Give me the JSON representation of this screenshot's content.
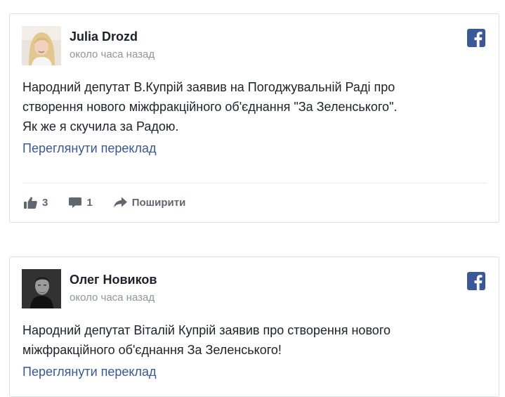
{
  "posts": [
    {
      "author": "Julia Drozd",
      "time": "около часа назад",
      "text_lines": [
        "Народний депутат В.Купрій заявив на Погоджувальній Раді про",
        "створення нового міжфракційного об'єднання \"За Зеленського\".",
        "Як же я скучила за Радою."
      ],
      "translate_label": "Переглянути переклад",
      "likes": "3",
      "comments": "1",
      "share_label": "Поширити"
    },
    {
      "author": "Олег Новиков",
      "time": "около часа назад",
      "text_lines": [
        "Народний депутат Віталій Купрій заявив про створення нового",
        "міжфракційного об'єднання За Зеленського!"
      ],
      "translate_label": "Переглянути переклад"
    }
  ],
  "icons": {
    "brand": "facebook-icon",
    "like": "thumbs-up-icon",
    "comment": "comment-icon",
    "share": "share-arrow-icon"
  },
  "colors": {
    "brand": "#3b5998",
    "link": "#385898",
    "muted": "#90949c",
    "action": "#616770",
    "border": "#dddfe2"
  }
}
